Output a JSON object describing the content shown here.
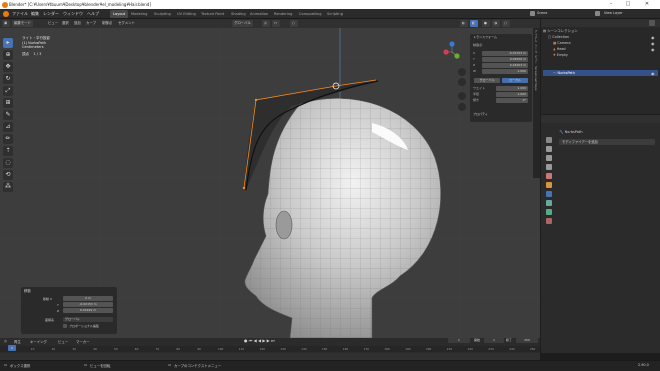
{
  "titlebar": {
    "title": "Blender* [C:¥Users¥tbuum¥Desktop¥blender¥el_modeling¥Hair.blend]",
    "minimize": "–",
    "maximize": "□",
    "close": "✕"
  },
  "menu": [
    "ファイル",
    "編集",
    "レンダー",
    "ウィンドウ",
    "ヘルプ"
  ],
  "workspaces": [
    {
      "label": "Layout",
      "active": true
    },
    {
      "label": "Modeling",
      "active": false
    },
    {
      "label": "Sculpting",
      "active": false
    },
    {
      "label": "UV Editing",
      "active": false
    },
    {
      "label": "Texture Paint",
      "active": false
    },
    {
      "label": "Shading",
      "active": false
    },
    {
      "label": "Animation",
      "active": false
    },
    {
      "label": "Rendering",
      "active": false
    },
    {
      "label": "Compositing",
      "active": false
    },
    {
      "label": "Scripting",
      "active": false
    }
  ],
  "scene": {
    "label": "Scene",
    "view_layer": "View Layer"
  },
  "header": {
    "mode": "編集モード",
    "menus": [
      "ビュー",
      "選択",
      "追加",
      "カーブ",
      "制御点",
      "セグメント"
    ],
    "orientation": "グローバル"
  },
  "viewport_info": {
    "line1": "ライト・平行投影",
    "line2": "(1) NurbsPath",
    "line3": "Centimeters",
    "line4_label": "頂点",
    "line4_value": "1 / 3"
  },
  "npanel": {
    "section": "トランスフォーム",
    "subtitle": "制御点:",
    "rows": [
      {
        "label": "X",
        "value": "-0.07153 m"
      },
      {
        "label": "Y",
        "value": "0.02506 m"
      },
      {
        "label": "Z",
        "value": "0.24203 m"
      },
      {
        "label": "W",
        "value": "1.000"
      }
    ],
    "space_label": "グローバル",
    "space_value": "ローカル",
    "weight_label": "ウエイト",
    "weight_value": "1.000",
    "radius_label": "半径",
    "radius_value": "1.000",
    "tilt_label": "傾き",
    "tilt_value": "0°",
    "properties": "プロパティ"
  },
  "vtabs": [
    "アイテム",
    "ツール",
    "ビュー",
    "Screencast Keys"
  ],
  "outliner": {
    "rows": [
      {
        "label": "シーンコレクション",
        "sel": false
      },
      {
        "label": "Collection",
        "sel": false
      },
      {
        "label": "Camera",
        "sel": false
      },
      {
        "label": "Head",
        "sel": false
      },
      {
        "label": "Empty",
        "sel": false
      },
      {
        "label": "NurbsPath",
        "sel": true
      }
    ]
  },
  "properties": {
    "object": "NurbsPath",
    "modifier": "モディファイアーを追加"
  },
  "operator_panel": {
    "title": "移動",
    "x_label": "移動 X",
    "x_value": "0 m",
    "y_label": "Y",
    "y_value": "-0.00153 m",
    "z_label": "Z",
    "z_value": "0.01499 m",
    "orient_label": "座標系",
    "orient_value": "グローバル",
    "checkbox_label": "プロポーショナル編集"
  },
  "timeline": {
    "menus": [
      "再生",
      "キーイング",
      "ビュー",
      "マーカー"
    ],
    "current": "1",
    "start_label": "開始",
    "start": "1",
    "end_label": "終了",
    "end": "250",
    "ticks": [
      "0",
      "10",
      "20",
      "30",
      "40",
      "50",
      "60",
      "70",
      "80",
      "90",
      "100",
      "110",
      "120",
      "130",
      "140",
      "150",
      "160",
      "170",
      "180",
      "190",
      "200",
      "210",
      "220",
      "230",
      "240",
      "250"
    ]
  },
  "status": {
    "item1": "ボックス選択",
    "item2": "ビューを回転",
    "item3": "カーブのコンテクストメニュー",
    "version": "2.90.0"
  },
  "colors": {
    "accent": "#4772b3",
    "select": "#ff8a18"
  }
}
